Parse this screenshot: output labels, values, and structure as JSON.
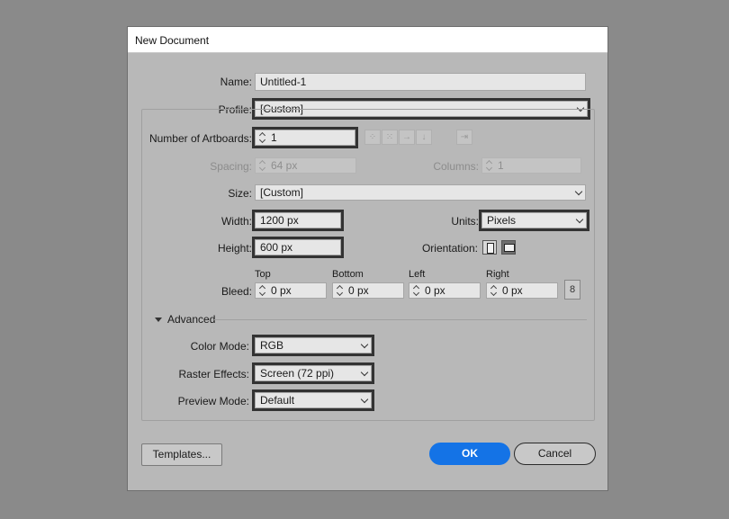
{
  "dialog": {
    "title": "New Document"
  },
  "name": {
    "label": "Name:",
    "value": "Untitled-1"
  },
  "profile": {
    "label": "Profile:",
    "value": "[Custom]"
  },
  "artboards": {
    "label": "Number of Artboards:",
    "value": "1"
  },
  "spacing": {
    "label": "Spacing:",
    "value": "64 px"
  },
  "columns": {
    "label": "Columns:",
    "value": "1"
  },
  "size": {
    "label": "Size:",
    "value": "[Custom]"
  },
  "width": {
    "label": "Width:",
    "value": "1200 px"
  },
  "units": {
    "label": "Units:",
    "value": "Pixels"
  },
  "height": {
    "label": "Height:",
    "value": "600 px"
  },
  "orientation": {
    "label": "Orientation:",
    "selected": "landscape"
  },
  "bleed": {
    "label": "Bleed:",
    "top": {
      "label": "Top",
      "value": "0 px"
    },
    "bottom": {
      "label": "Bottom",
      "value": "0 px"
    },
    "left": {
      "label": "Left",
      "value": "0 px"
    },
    "right": {
      "label": "Right",
      "value": "0 px"
    }
  },
  "advanced": {
    "label": "Advanced",
    "color_mode": {
      "label": "Color Mode:",
      "value": "RGB"
    },
    "raster_effects": {
      "label": "Raster Effects:",
      "value": "Screen (72 ppi)"
    },
    "preview_mode": {
      "label": "Preview Mode:",
      "value": "Default"
    }
  },
  "buttons": {
    "templates": "Templates...",
    "ok": "OK",
    "cancel": "Cancel"
  },
  "colors": {
    "accent": "#1473e6",
    "dialog_bg": "#b8b8b8",
    "backdrop": "#8a8a8a",
    "highlight": "#333333"
  }
}
